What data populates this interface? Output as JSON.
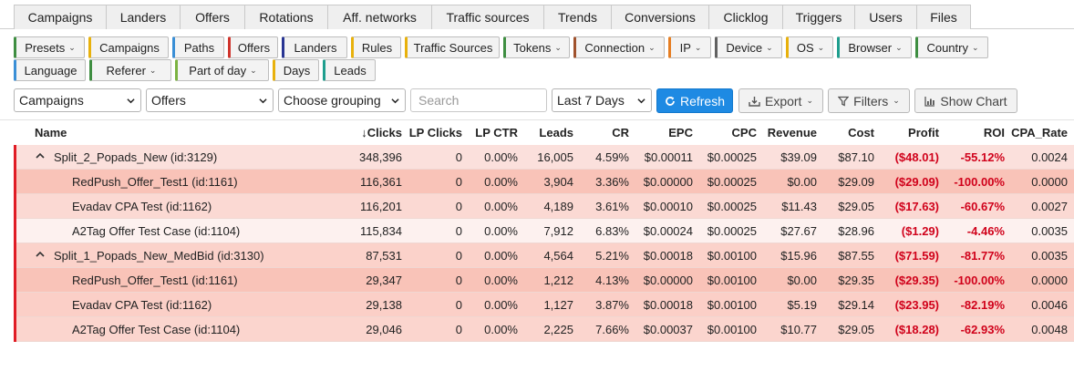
{
  "nav_tabs": [
    "Campaigns",
    "Landers",
    "Offers",
    "Rotations",
    "Aff. networks",
    "Traffic sources",
    "Trends",
    "Conversions",
    "Clicklog",
    "Triggers",
    "Users",
    "Files"
  ],
  "chips_row1": [
    {
      "label": "Presets",
      "caret": true,
      "color": "#3e8e41"
    },
    {
      "label": "Campaigns",
      "caret": false,
      "color": "#e8b10c"
    },
    {
      "label": "Paths",
      "caret": false,
      "color": "#3a8fd6"
    },
    {
      "label": "Offers",
      "caret": false,
      "color": "#d0342c"
    },
    {
      "label": "Landers",
      "caret": false,
      "color": "#283593"
    },
    {
      "label": "Rules",
      "caret": false,
      "color": "#e8b10c"
    },
    {
      "label": "Traffic Sources",
      "caret": false,
      "color": "#e8b10c"
    },
    {
      "label": "Tokens",
      "caret": true,
      "color": "#3e8e41"
    },
    {
      "label": "Connection",
      "caret": true,
      "color": "#a0522d"
    },
    {
      "label": "IP",
      "caret": true,
      "color": "#e67e22"
    },
    {
      "label": "Device",
      "caret": true,
      "color": "#616161"
    },
    {
      "label": "OS",
      "caret": true,
      "color": "#e8b10c"
    },
    {
      "label": "Browser",
      "caret": true,
      "color": "#1e9e8e"
    },
    {
      "label": "Country",
      "caret": true,
      "color": "#3e8e41"
    }
  ],
  "chips_row2": [
    {
      "label": "Language",
      "caret": false,
      "color": "#3a8fd6"
    },
    {
      "label": "Referer",
      "caret": true,
      "color": "#3e8e41"
    },
    {
      "label": "Part of day",
      "caret": true,
      "color": "#7cb342"
    },
    {
      "label": "Days",
      "caret": false,
      "color": "#e8b10c"
    },
    {
      "label": "Leads",
      "caret": false,
      "color": "#1e9e8e"
    }
  ],
  "toolbar": {
    "group1": "Campaigns",
    "group2": "Offers",
    "group3": "Choose grouping",
    "search_placeholder": "Search",
    "date_range": "Last 7 Days",
    "refresh_label": "Refresh",
    "export_label": "Export",
    "filters_label": "Filters",
    "show_chart_label": "Show Chart"
  },
  "columns": [
    "Name",
    "Clicks",
    "LP Clicks",
    "LP CTR",
    "Leads",
    "CR",
    "EPC",
    "CPC",
    "Revenue",
    "Cost",
    "Profit",
    "ROI",
    "CPA_Rate"
  ],
  "sort_indicator": "↓",
  "rows": [
    {
      "type": "group",
      "name": "Split_2_Popads_New (id:3129)",
      "cells": [
        "348,396",
        "0",
        "0.00%",
        "16,005",
        "4.59%",
        "$0.00011",
        "$0.00025",
        "$39.09",
        "$87.10",
        "($48.01)",
        "-55.12%",
        "0.0024"
      ],
      "bg": "#fbe0dc"
    },
    {
      "type": "child",
      "name": "RedPush_Offer_Test1 (id:1161)",
      "cells": [
        "116,361",
        "0",
        "0.00%",
        "3,904",
        "3.36%",
        "$0.00000",
        "$0.00025",
        "$0.00",
        "$29.09",
        "($29.09)",
        "-100.00%",
        "0.0000"
      ],
      "bg": "#f9c3b8"
    },
    {
      "type": "child",
      "name": "Evadav CPA Test (id:1162)",
      "cells": [
        "116,201",
        "0",
        "0.00%",
        "4,189",
        "3.61%",
        "$0.00010",
        "$0.00025",
        "$11.43",
        "$29.05",
        "($17.63)",
        "-60.67%",
        "0.0027"
      ],
      "bg": "#fbd9d3"
    },
    {
      "type": "child",
      "name": "A2Tag Offer Test Case (id:1104)",
      "cells": [
        "115,834",
        "0",
        "0.00%",
        "7,912",
        "6.83%",
        "$0.00024",
        "$0.00025",
        "$27.67",
        "$28.96",
        "($1.29)",
        "-4.46%",
        "0.0035"
      ],
      "bg": "#fdf1ef"
    },
    {
      "type": "group",
      "name": "Split_1_Popads_New_MedBid (id:3130)",
      "cells": [
        "87,531",
        "0",
        "0.00%",
        "4,564",
        "5.21%",
        "$0.00018",
        "$0.00100",
        "$15.96",
        "$87.55",
        "($71.59)",
        "-81.77%",
        "0.0035"
      ],
      "bg": "#fbd2ca"
    },
    {
      "type": "child",
      "name": "RedPush_Offer_Test1 (id:1161)",
      "cells": [
        "29,347",
        "0",
        "0.00%",
        "1,212",
        "4.13%",
        "$0.00000",
        "$0.00100",
        "$0.00",
        "$29.35",
        "($29.35)",
        "-100.00%",
        "0.0000"
      ],
      "bg": "#f9c3b8"
    },
    {
      "type": "child",
      "name": "Evadav CPA Test (id:1162)",
      "cells": [
        "29,138",
        "0",
        "0.00%",
        "1,127",
        "3.87%",
        "$0.00018",
        "$0.00100",
        "$5.19",
        "$29.14",
        "($23.95)",
        "-82.19%",
        "0.0046"
      ],
      "bg": "#fbcfc7"
    },
    {
      "type": "child",
      "name": "A2Tag Offer Test Case (id:1104)",
      "cells": [
        "29,046",
        "0",
        "0.00%",
        "2,225",
        "7.66%",
        "$0.00037",
        "$0.00100",
        "$10.77",
        "$29.05",
        "($18.28)",
        "-62.93%",
        "0.0048"
      ],
      "bg": "#fbd5ce"
    }
  ]
}
